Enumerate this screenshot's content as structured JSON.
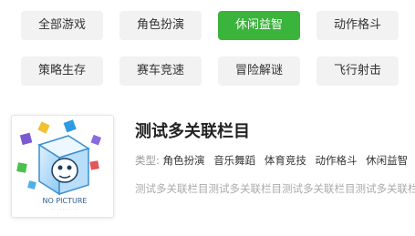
{
  "categories_row1": [
    "全部游戏",
    "角色扮演",
    "休闲益智",
    "动作格斗",
    ""
  ],
  "categories_row2": [
    "策略生存",
    "赛车竞速",
    "冒险解谜",
    "飞行射击"
  ],
  "active_category": "休闲益智",
  "active_color": "#3bb43b",
  "game": {
    "title": "测试多关联栏目",
    "type_label": "类型:",
    "types": [
      "角色扮演",
      "音乐舞蹈",
      "体育竞技",
      "动作格斗",
      "休闲益智"
    ],
    "description": "测试多关联栏目测试多关联栏目测试多关联栏目测试多关联栏目",
    "thumbnail_text": "NO PICTURE",
    "thumbnail_icon": "no-picture-cube-icon"
  }
}
